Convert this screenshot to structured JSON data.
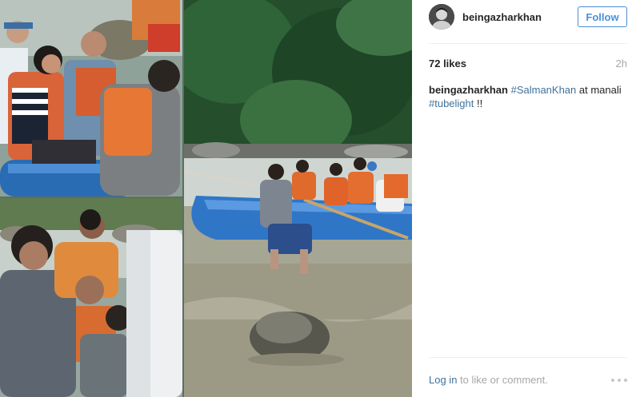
{
  "post": {
    "username": "beingazharkhan",
    "follow_label": "Follow",
    "likes": "72 likes",
    "time_ago": "2h",
    "caption": {
      "username": "beingazharkhan",
      "mention": "#SalmanKhan",
      "text_mid": " at manali ",
      "hashtag": "#tubelight",
      "text_end": " !!"
    },
    "footer": {
      "login_link": "Log in",
      "login_suffix": " to like or comment."
    },
    "more_icon": "more-options-icon"
  },
  "photos": [
    {
      "name": "rafting-group-closeup-photo"
    },
    {
      "name": "riverbank-crowd-photo"
    },
    {
      "name": "river-raft-photo"
    }
  ],
  "colors": {
    "link": "#3f729b",
    "follow_border": "#4b8cd9",
    "muted": "#a5a7aa",
    "divider": "#efefef"
  }
}
